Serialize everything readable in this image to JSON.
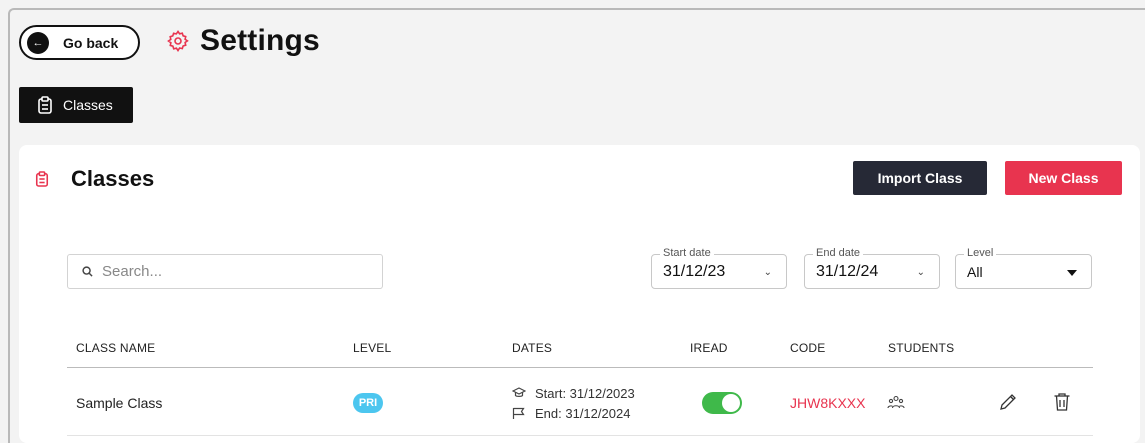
{
  "header": {
    "back_label": "Go back",
    "title": "Settings"
  },
  "tabs": [
    {
      "label": "Classes",
      "active": true
    }
  ],
  "classes": {
    "title": "Classes",
    "import_label": "Import Class",
    "new_label": "New Class",
    "search_placeholder": "Search...",
    "filters": {
      "start_date": {
        "label": "Start date",
        "value": "31/12/23"
      },
      "end_date": {
        "label": "End date",
        "value": "31/12/24"
      },
      "level": {
        "label": "Level",
        "value": "All"
      }
    },
    "columns": [
      "CLASS NAME",
      "LEVEL",
      "DATES",
      "IREAD",
      "CODE",
      "STUDENTS"
    ],
    "rows": [
      {
        "name": "Sample Class",
        "level": "PRI",
        "start": "Start: 31/12/2023",
        "end": "End: 31/12/2024",
        "iread": true,
        "code": "JHW8KXXX"
      }
    ]
  },
  "colors": {
    "accent": "#e8344f",
    "dark_button": "#262936",
    "badge": "#4cc6ef",
    "toggle_on": "#3fb94a"
  },
  "icons": [
    "arrow-left-icon",
    "gear-icon",
    "clipboard-icon",
    "search-icon",
    "graduation-cap-icon",
    "flag-icon",
    "students-icon",
    "pencil-icon",
    "trash-icon"
  ]
}
